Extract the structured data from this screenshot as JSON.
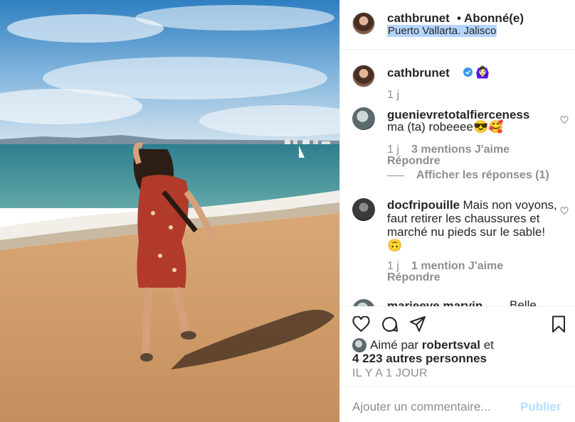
{
  "post": {
    "author": "cathbrunet",
    "separator": "•",
    "follow_status": "Abonné(e)",
    "location": "Puerto Vallarta. Jalisco"
  },
  "caption": {
    "author": "cathbrunet",
    "verified_icon": "verified-badge-icon",
    "emoji": "🙆🏻‍♀️",
    "time": "1 j"
  },
  "comments": [
    {
      "user": "guenievretotalfierceness",
      "text": "ma (ta) robeeee😎🥰",
      "time": "1 j",
      "likes": "3 mentions J'aime",
      "reply": "Répondre",
      "view_replies": "Afficher les réponses (1)"
    },
    {
      "user": "docfripouille",
      "text": "Mais non voyons, faut retirer les chaussures et marché nu pieds sur le sable!🙃",
      "time": "1 j",
      "likes": "1 mention J'aime",
      "reply": "Répondre"
    },
    {
      "user": "marieeve.marvin",
      "text": "Belle"
    }
  ],
  "likes": {
    "liked_by_prefix": "Aimé par",
    "liked_by_user": "robertsval",
    "and": "et",
    "others": "4 223 autres personnes"
  },
  "timestamp": "IL Y A 1 JOUR",
  "add_comment": {
    "placeholder": "Ajouter un commentaire...",
    "publish": "Publier"
  },
  "colors": {
    "link_blue": "#0095f6",
    "publish_disabled": "#b2dffc",
    "meta_gray": "#8e8e8e",
    "selection": "#b4d5fe"
  }
}
